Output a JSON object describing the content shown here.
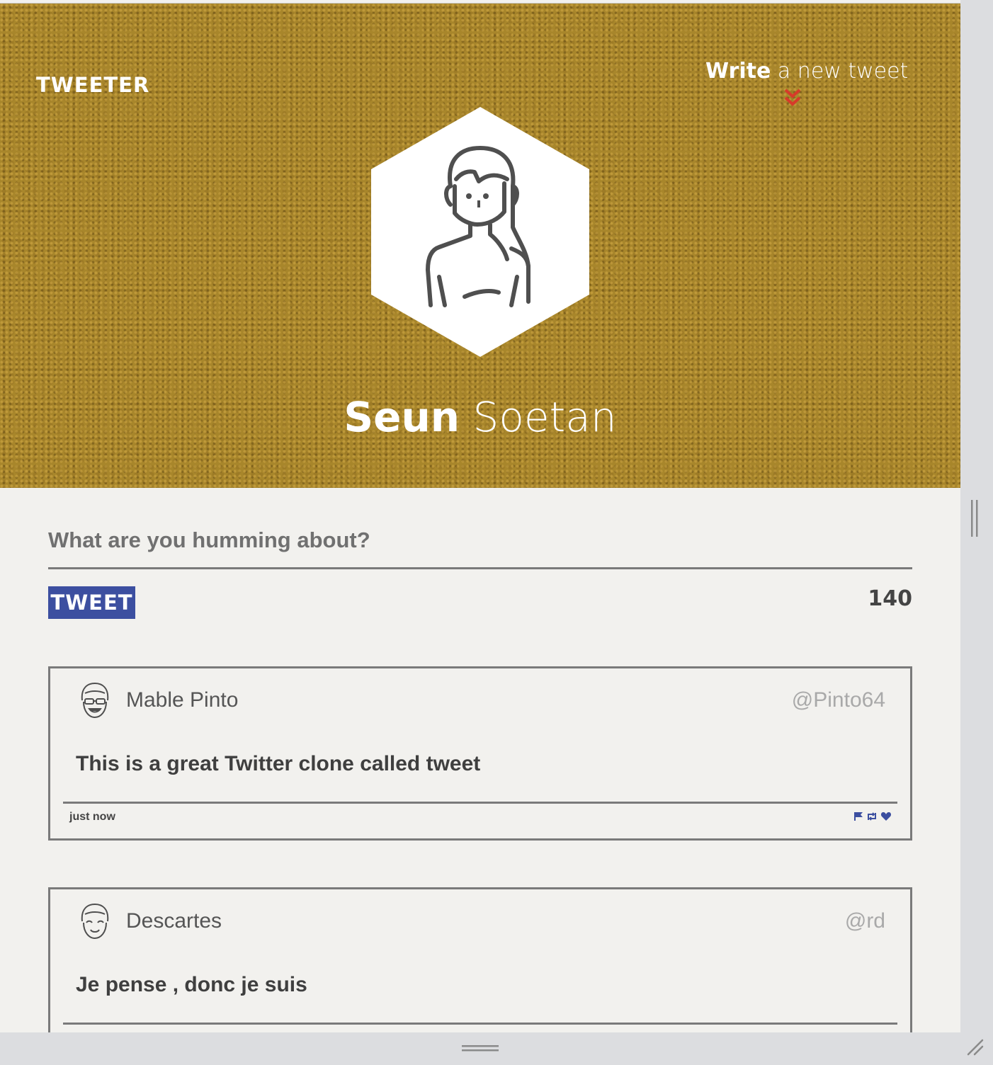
{
  "app": {
    "logo": "TWEETER"
  },
  "header": {
    "write_bold": "Write",
    "write_rest": " a new tweet",
    "profile_first": "Seun",
    "profile_last": " Soetan"
  },
  "composer": {
    "placeholder": "What are you humming about?",
    "value": "",
    "button_label": "TWEET",
    "counter": "140"
  },
  "tweets": [
    {
      "name": "Mable Pinto",
      "handle": "@Pinto64",
      "content": "This is a great Twitter clone called tweet",
      "time": "just now"
    },
    {
      "name": "Descartes",
      "handle": "@rd",
      "content": "Je pense , donc je suis"
    }
  ],
  "colors": {
    "header_bg": "#a8862b",
    "tweet_button": "#3c4fa0",
    "chevron": "#d63a2a",
    "action_icons": "#3c4fa0"
  },
  "icons": [
    "chevron-double-down-icon",
    "flag-icon",
    "retweet-icon",
    "heart-icon"
  ]
}
